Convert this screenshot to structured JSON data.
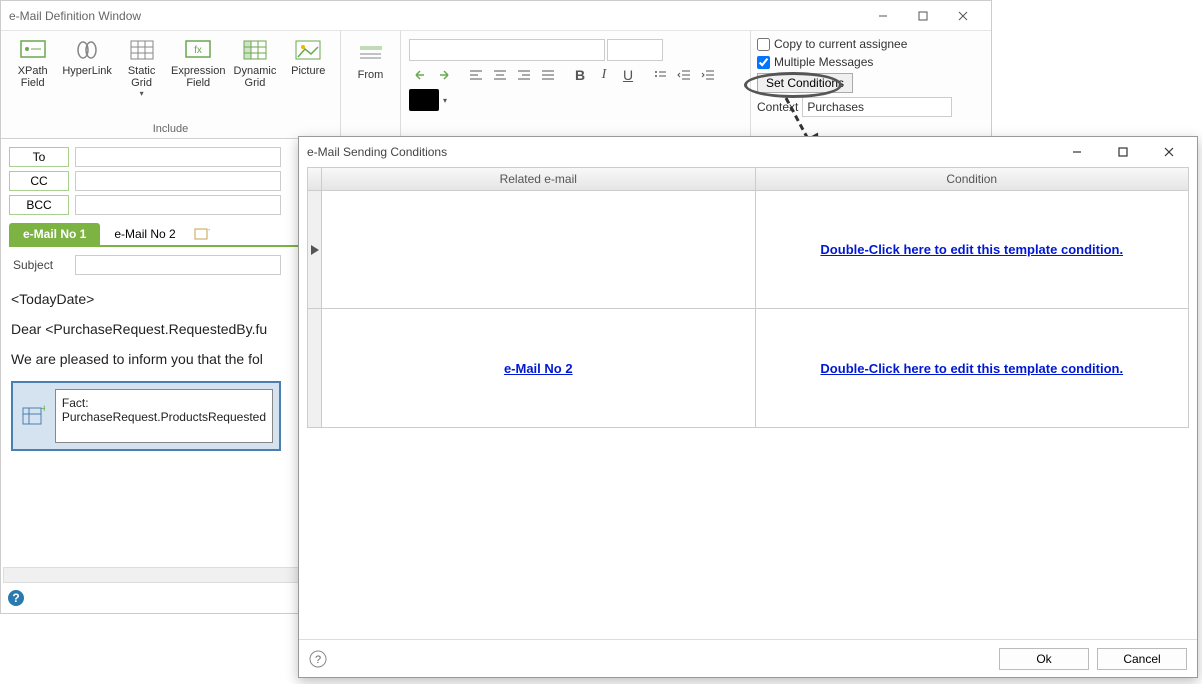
{
  "window": {
    "title": "e-Mail Definition Window"
  },
  "ribbon": {
    "include": {
      "label": "Include",
      "buttons": {
        "xpath": "XPath Field",
        "hyperlink": "HyperLink",
        "static_grid": "Static Grid",
        "expression_field": "Expression Field",
        "dynamic_grid": "Dynamic Grid",
        "picture": "Picture"
      }
    },
    "from": {
      "label": "From"
    },
    "options": {
      "copy_assignee": "Copy to current assignee",
      "multiple_messages": "Multiple Messages",
      "set_conditions": "Set Conditions",
      "context_label": "Context",
      "context_value": "Purchases"
    }
  },
  "recipients": {
    "to": "To",
    "cc": "CC",
    "bcc": "BCC"
  },
  "tabs": {
    "tab1": "e-Mail No  1",
    "tab2": "e-Mail No  2"
  },
  "subject": {
    "label": "Subject"
  },
  "body": {
    "line1": "<TodayDate>",
    "line2": "Dear <PurchaseRequest.RequestedBy.fu",
    "line3": "We are pleased to inform you that the fol",
    "fact": "Fact: PurchaseRequest.ProductsRequested"
  },
  "modal": {
    "title": "e-Mail Sending Conditions",
    "headers": {
      "related": "Related e-mail",
      "condition": "Condition"
    },
    "rows": [
      {
        "related": "",
        "condition": "Double-Click here to edit this template condition."
      },
      {
        "related": "e-Mail No  2",
        "condition": "Double-Click here to edit this template condition."
      }
    ],
    "buttons": {
      "ok": "Ok",
      "cancel": "Cancel"
    }
  }
}
